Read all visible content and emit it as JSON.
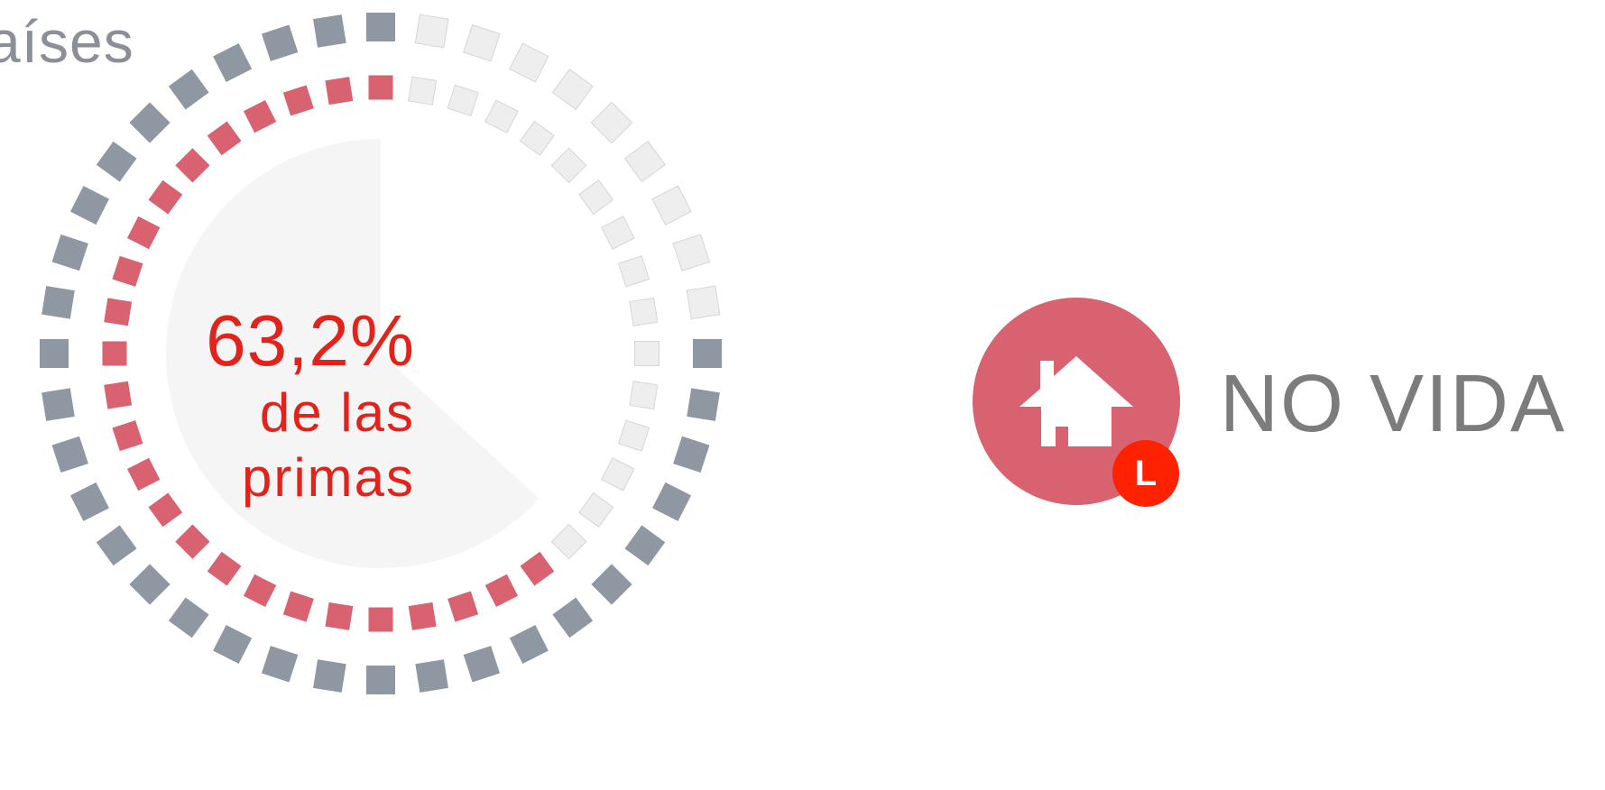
{
  "header": {
    "title_fragment": "aíses"
  },
  "chart_data": {
    "type": "radial-dot",
    "value_percent": 63.2,
    "value_label": "63,2%",
    "sublabel_lines": [
      "de las",
      "primas"
    ],
    "outer_ring": {
      "segments": 40,
      "filled_segments": 31,
      "filled_color": "#8f97a3",
      "empty_color": "#eeeeee"
    },
    "inner_ring": {
      "segments": 40,
      "filled_segments": 25,
      "filled_color": "#d8626f",
      "empty_color": "#eeeeee"
    },
    "pie": {
      "share": 0.632,
      "color": "#f4f5f4"
    }
  },
  "category": {
    "label": "NO VIDA",
    "icon": "house-icon",
    "badge": "L",
    "circle_color": "#d8626f",
    "badge_color": "#ff2200"
  }
}
